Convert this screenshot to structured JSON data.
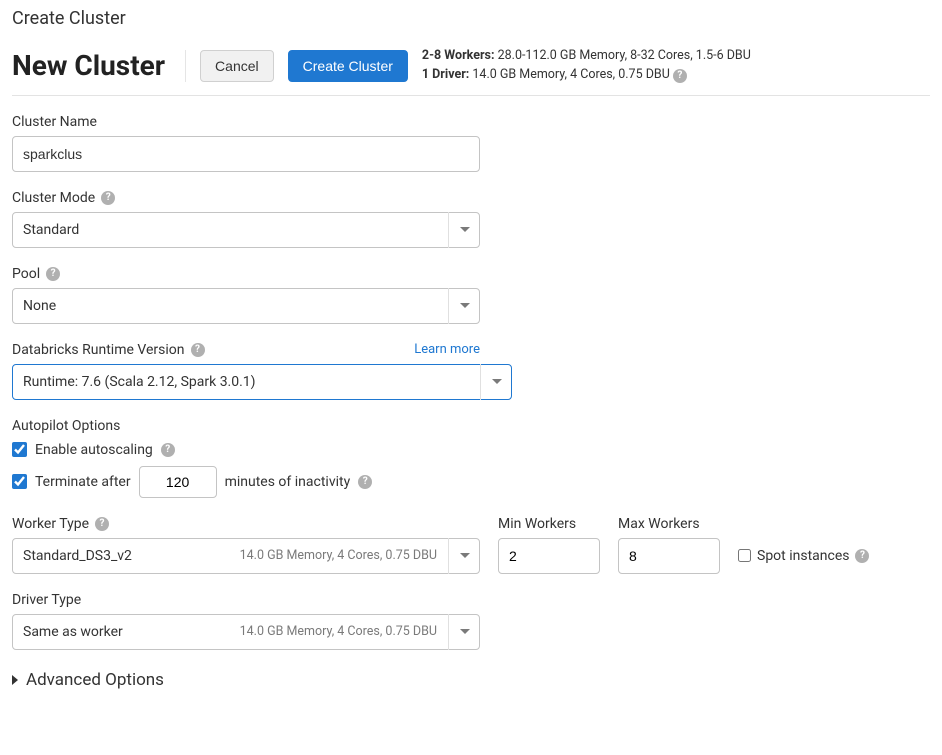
{
  "header": {
    "super_title": "Create Cluster",
    "title": "New Cluster",
    "cancel_label": "Cancel",
    "create_label": "Create Cluster",
    "summary": {
      "workers_label": "2-8 Workers:",
      "workers_detail": "28.0-112.0 GB Memory, 8-32 Cores, 1.5-6 DBU",
      "driver_label": "1 Driver:",
      "driver_detail": "14.0 GB Memory, 4 Cores, 0.75 DBU"
    }
  },
  "form": {
    "cluster_name": {
      "label": "Cluster Name",
      "value": "sparkclus"
    },
    "cluster_mode": {
      "label": "Cluster Mode",
      "value": "Standard"
    },
    "pool": {
      "label": "Pool",
      "value": "None"
    },
    "runtime": {
      "label": "Databricks Runtime Version",
      "learn_more": "Learn more",
      "value": "Runtime: 7.6 (Scala 2.12, Spark 3.0.1)"
    },
    "autopilot": {
      "section_label": "Autopilot Options",
      "enable_autoscaling_label": "Enable autoscaling",
      "enable_autoscaling_checked": true,
      "terminate_checked": true,
      "terminate_prefix": "Terminate after",
      "terminate_minutes": "120",
      "terminate_suffix": "minutes of inactivity"
    },
    "worker_type": {
      "label": "Worker Type",
      "value": "Standard_DS3_v2",
      "meta": "14.0 GB Memory, 4 Cores, 0.75 DBU"
    },
    "min_workers": {
      "label": "Min Workers",
      "value": "2"
    },
    "max_workers": {
      "label": "Max Workers",
      "value": "8"
    },
    "spot": {
      "label": "Spot instances",
      "checked": false
    },
    "driver_type": {
      "label": "Driver Type",
      "value": "Same as worker",
      "meta": "14.0 GB Memory, 4 Cores, 0.75 DBU"
    },
    "advanced_label": "Advanced Options"
  }
}
